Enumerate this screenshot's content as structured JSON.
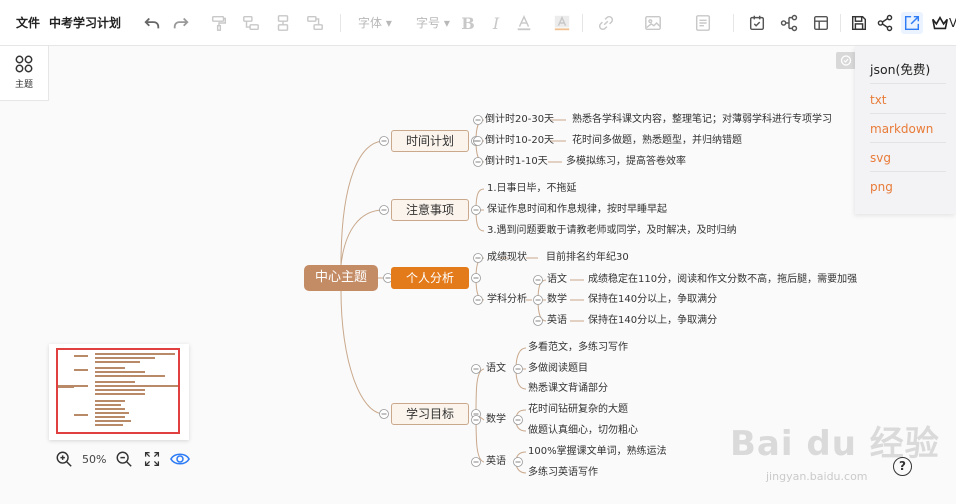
{
  "toolbar": {
    "file_menu": "文件",
    "doc_title": "中考学习计划",
    "font_select": "字体",
    "size_select": "字号",
    "vip_label": "V"
  },
  "theme": {
    "label": "主题"
  },
  "export_menu": {
    "items": [
      "json(免费)",
      "txt",
      "markdown",
      "svg",
      "png"
    ]
  },
  "mindmap": {
    "root": "中心主题",
    "branches": [
      {
        "label": "时间计划",
        "children": [
          {
            "label": "倒计时20-30天",
            "detail": "熟悉各学科课文内容，整理笔记；对薄弱学科进行专项学习"
          },
          {
            "label": "倒计时10-20天",
            "detail": "花时间多做题，熟悉题型，并归纳错题"
          },
          {
            "label": "倒计时1-10天",
            "detail": "多模拟练习，提高答卷效率"
          }
        ]
      },
      {
        "label": "注意事项",
        "children": [
          {
            "label": "1.日事日毕，不拖延"
          },
          {
            "label": "保证作息时间和作息规律，按时早睡早起"
          },
          {
            "label": "3.遇到问题要敢于请教老师或同学，及时解决，及时归纳"
          }
        ]
      },
      {
        "label": "个人分析",
        "children": [
          {
            "label": "成绩现状",
            "detail": "目前排名约年纪30"
          },
          {
            "label": "学科分析",
            "children": [
              {
                "label": "语文",
                "detail": "成绩稳定在110分，阅读和作文分数不高，拖后腿，需要加强"
              },
              {
                "label": "数学",
                "detail": "保持在140分以上，争取满分"
              },
              {
                "label": "英语",
                "detail": "保持在140分以上，争取满分"
              }
            ]
          }
        ]
      },
      {
        "label": "学习目标",
        "children": [
          {
            "label": "语文",
            "children": [
              "多看范文，多练习写作",
              "多做阅读题目",
              "熟悉课文背诵部分"
            ]
          },
          {
            "label": "数学",
            "children": [
              "花时间钻研复杂的大题",
              "做题认真细心，切勿粗心"
            ]
          },
          {
            "label": "英语",
            "children": [
              "100%掌握课文单词，熟练运法",
              "多练习英语写作"
            ]
          }
        ]
      }
    ]
  },
  "zoom": {
    "level": "50%"
  },
  "help": {
    "label": "?"
  },
  "watermark": {
    "main": "Bai du 经验",
    "sub": "jingyan.baidu.com"
  },
  "colors": {
    "accent": "#e37b1a",
    "root": "#c48c65",
    "line": "#c9a88b",
    "export_link": "#e87b38",
    "minimap_frame": "#e04040"
  },
  "icons": [
    "undo-icon",
    "redo-icon",
    "format-painter-icon",
    "insert-sibling-icon",
    "insert-child-icon",
    "insert-parent-icon",
    "bold-icon",
    "italic-icon",
    "font-color-icon",
    "highlight-icon",
    "link-icon",
    "image-icon",
    "note-icon",
    "task-icon",
    "relationship-icon",
    "layout-icon",
    "save-icon",
    "share-icon",
    "export-icon",
    "crown-icon",
    "theme-grid-icon",
    "zoom-in-icon",
    "zoom-out-icon",
    "fit-screen-icon",
    "eye-icon",
    "lock-icon",
    "help-icon"
  ]
}
